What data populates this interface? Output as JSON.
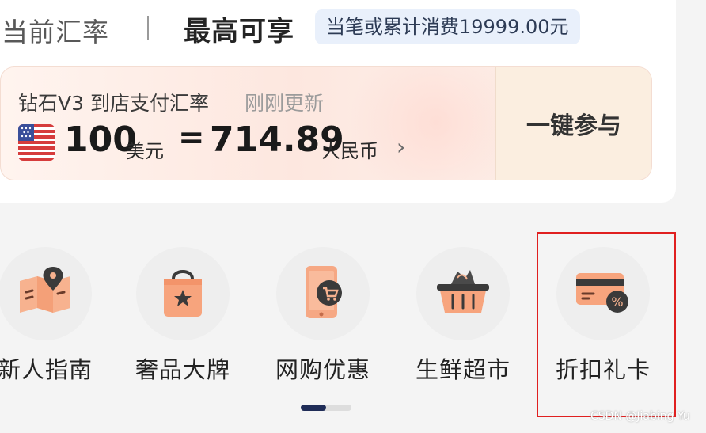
{
  "header": {
    "current_rate_label": "当前汇率",
    "separator": "|",
    "max_label": "最高可享",
    "badge_text": "当笔或累计消费19999.00元"
  },
  "rate_card": {
    "title": "钻石V3 到店支付汇率",
    "updated": "刚刚更新",
    "amount": "100",
    "amount_unit": "美元",
    "equals": "=",
    "value": "714.89",
    "value_unit": "人民币",
    "chevron": "›",
    "flag_icon": "us-flag-icon",
    "join_label": "一键参与"
  },
  "nav": {
    "items": [
      {
        "label": "新人指南",
        "icon": "guide-map-icon"
      },
      {
        "label": "奢品大牌",
        "icon": "shopping-bag-icon"
      },
      {
        "label": "网购优惠",
        "icon": "phone-cart-icon"
      },
      {
        "label": "生鲜超市",
        "icon": "basket-icon"
      },
      {
        "label": "折扣礼卡",
        "icon": "discount-card-icon"
      }
    ],
    "highlighted_index": 4
  },
  "pager": {
    "page": 1,
    "total": 2
  },
  "watermark": "CSDN @Jiabing Yu",
  "colors": {
    "accent_icon": "#f5a27e",
    "pager_active": "#1f2c57",
    "highlight": "#e02020",
    "badge_bg": "#e9f0fb"
  }
}
